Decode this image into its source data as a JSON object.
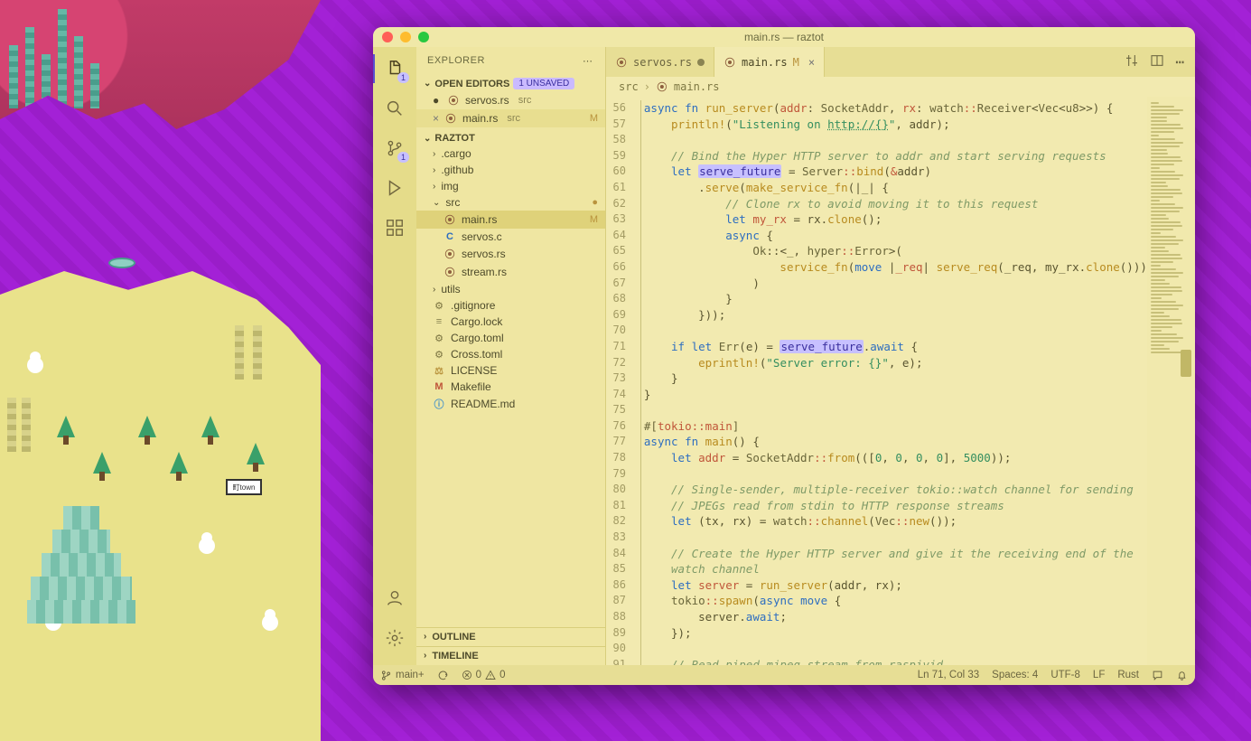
{
  "window": {
    "title": "main.rs — raztot"
  },
  "activityBar": {
    "items": [
      {
        "name": "explorer",
        "badge": "1"
      },
      {
        "name": "search"
      },
      {
        "name": "source-control",
        "badge": "1"
      },
      {
        "name": "run-debug"
      },
      {
        "name": "extensions"
      }
    ]
  },
  "sidebar": {
    "title": "EXPLORER",
    "openEditors": {
      "label": "OPEN EDITORS",
      "unsaved": "1 UNSAVED",
      "items": [
        {
          "name": "servos.rs",
          "sub": "src",
          "dirty": true,
          "icon": "rust"
        },
        {
          "name": "main.rs",
          "sub": "src",
          "mark": "M",
          "icon": "rust"
        }
      ]
    },
    "project": {
      "label": "RAZTOT",
      "tree": [
        {
          "kind": "folder",
          "name": ".cargo"
        },
        {
          "kind": "folder",
          "name": ".github"
        },
        {
          "kind": "folder",
          "name": "img"
        },
        {
          "kind": "folder",
          "name": "src",
          "open": true,
          "children": [
            {
              "kind": "file",
              "name": "main.rs",
              "icon": "rust",
              "mark": "M",
              "active": true
            },
            {
              "kind": "file",
              "name": "servos.c",
              "icon": "c"
            },
            {
              "kind": "file",
              "name": "servos.rs",
              "icon": "rust"
            },
            {
              "kind": "file",
              "name": "stream.rs",
              "icon": "rust"
            }
          ]
        },
        {
          "kind": "folder",
          "name": "utils"
        },
        {
          "kind": "file",
          "name": ".gitignore",
          "icon": "gear"
        },
        {
          "kind": "file",
          "name": "Cargo.lock",
          "icon": "plain"
        },
        {
          "kind": "file",
          "name": "Cargo.toml",
          "icon": "gear"
        },
        {
          "kind": "file",
          "name": "Cross.toml",
          "icon": "gear"
        },
        {
          "kind": "file",
          "name": "LICENSE",
          "icon": "lic"
        },
        {
          "kind": "file",
          "name": "Makefile",
          "icon": "m"
        },
        {
          "kind": "file",
          "name": "README.md",
          "icon": "info"
        }
      ]
    },
    "bottom": [
      {
        "label": "OUTLINE"
      },
      {
        "label": "TIMELINE"
      }
    ]
  },
  "tabs": [
    {
      "name": "servos.rs",
      "icon": "rust",
      "dirty": true
    },
    {
      "name": "main.rs",
      "icon": "rust",
      "mark": "M",
      "active": true
    }
  ],
  "breadcrumb": [
    "src",
    "main.rs"
  ],
  "editor": {
    "firstLine": 56,
    "lines": [
      "<span class='kw'>async</span> <span class='kw'>fn</span> <span class='call'>run_server</span>(<span class='ident'>addr</span>: <span class='ty'>SocketAddr</span>, <span class='ident'>rx</span>: <span class='ty'>watch</span><span class='op'>::</span><span class='ty'>Receiver</span>&lt;<span class='ty'>Vec</span>&lt;<span class='ty'>u8</span>&gt;&gt;) {",
      "    <span class='call'>println!</span>(<span class='str'>\"Listening on <span class='url'>http://{}</span>\"</span>, addr);",
      "",
      "    <span class='cmt'>// Bind the Hyper HTTP server to addr and start serving requests</span>",
      "    <span class='kw'>let</span> <span class='sel'>serve_future</span> = <span class='ty'>Server</span><span class='op'>::</span><span class='call'>bind</span>(<span class='op'>&amp;</span>addr)",
      "        .<span class='call'>serve</span>(<span class='call'>make_service_fn</span>(|<span class='pnc'>_</span>| {",
      "            <span class='cmt'>// Clone rx to avoid moving it to this request</span>",
      "            <span class='kw'>let</span> <span class='ident'>my_rx</span> = rx.<span class='call'>clone</span>();",
      "            <span class='kw'>async</span> {",
      "                <span class='ty'>Ok</span>::&lt;<span class='pnc'>_</span>, <span class='ty'>hyper</span><span class='op'>::</span><span class='ty'>Error</span>&gt;(",
      "                    <span class='call'>service_fn</span>(<span class='kw'>move</span> |<span class='ident'>_req</span>| <span class='call'>serve_req</span>(_req, my_rx.<span class='call'>clone</span>()))",
      "                )",
      "            }",
      "        }));",
      "",
      "    <span class='kw'>if</span> <span class='kw'>let</span> <span class='ty'>Err</span>(e) = <span class='sel'>serve_future</span>.<span class='kw'>await</span> {",
      "        <span class='call'>eprintln!</span>(<span class='str'>\"Server error: {}\"</span>, e);",
      "    }",
      "}",
      "",
      "<span class='pnc'>#[</span><span class='ident'>tokio</span><span class='op'>::</span><span class='ident'>main</span><span class='pnc'>]</span>",
      "<span class='kw'>async</span> <span class='kw'>fn</span> <span class='call'>main</span>() {",
      "    <span class='kw'>let</span> <span class='ident'>addr</span> = <span class='ty'>SocketAddr</span><span class='op'>::</span><span class='call'>from</span>(([<span class='num'>0</span>, <span class='num'>0</span>, <span class='num'>0</span>, <span class='num'>0</span>], <span class='num'>5000</span>));",
      "",
      "    <span class='cmt'>// Single-sender, multiple-receiver tokio::watch channel for sending</span>",
      "    <span class='cmt'>// JPEGs read from stdin to HTTP response streams</span>",
      "    <span class='kw'>let</span> (tx, rx) = <span class='ty'>watch</span><span class='op'>::</span><span class='call'>channel</span>(<span class='ty'>Vec</span><span class='op'>::</span><span class='call'>new</span>());",
      "",
      "    <span class='cmt'>// Create the Hyper HTTP server and give it the receiving end of the</span>",
      "    <span class='cmt'>watch channel</span>",
      "    <span class='kw'>let</span> <span class='ident'>server</span> = <span class='call'>run_server</span>(addr, rx);",
      "    <span class='ty'>tokio</span><span class='op'>::</span><span class='call'>spawn</span>(<span class='kw'>async</span> <span class='kw'>move</span> {",
      "        server.<span class='kw'>await</span>;",
      "    });",
      "",
      "    <span class='cmt'>// Read piped mjpeg stream from raspivid</span>"
    ]
  },
  "status": {
    "branch": "main+",
    "errors": "0",
    "warnings": "0",
    "pos": "Ln 71, Col 33",
    "spaces": "Spaces: 4",
    "encoding": "UTF-8",
    "eol": "LF",
    "lang": "Rust"
  },
  "signText": "町town"
}
